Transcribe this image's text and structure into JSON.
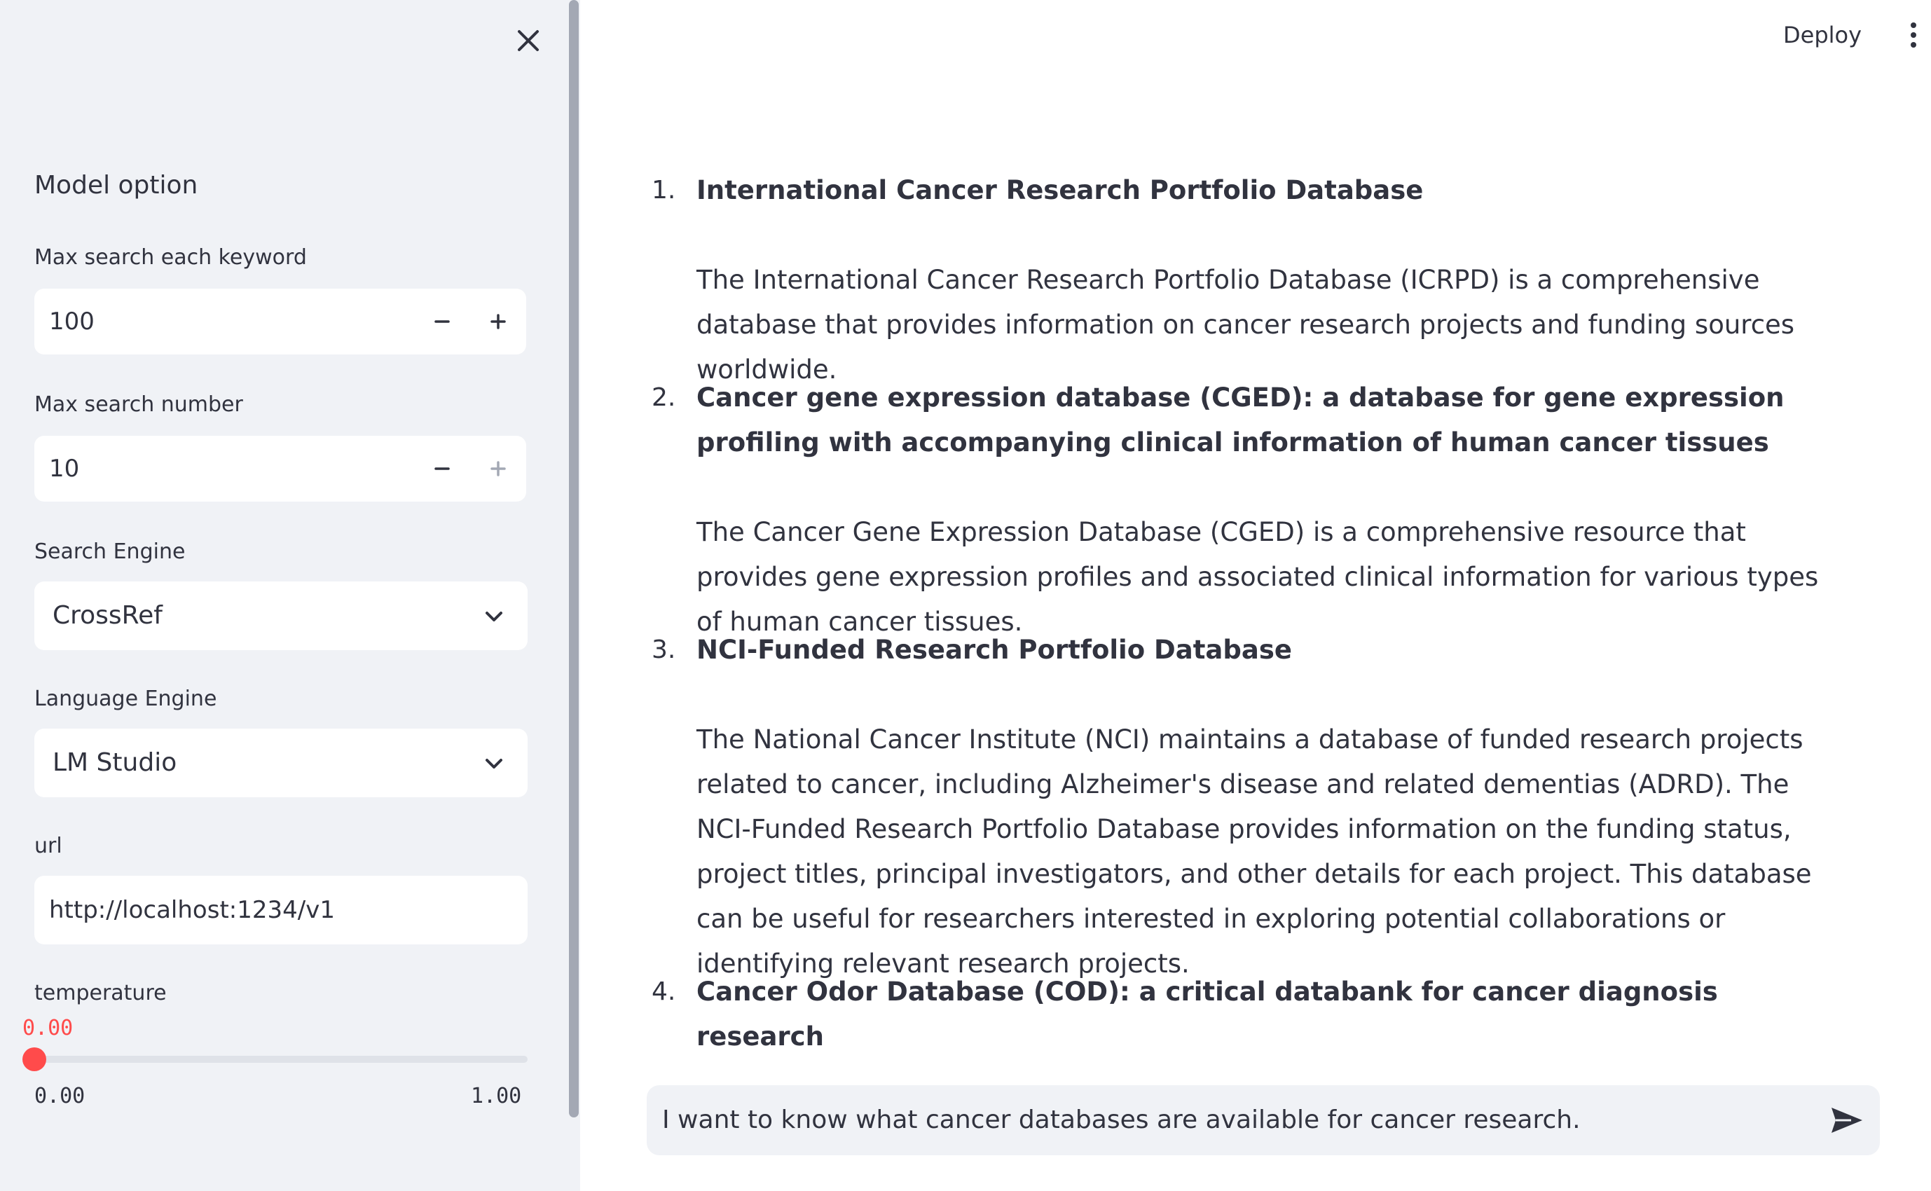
{
  "header": {
    "deploy_label": "Deploy"
  },
  "sidebar": {
    "heading": "Model option",
    "max_search_keyword": {
      "label": "Max search each keyword",
      "value": "100"
    },
    "max_search_number": {
      "label": "Max search number",
      "value": "10"
    },
    "search_engine": {
      "label": "Search Engine",
      "value": "CrossRef"
    },
    "language_engine": {
      "label": "Language Engine",
      "value": "LM Studio"
    },
    "url": {
      "label": "url",
      "value": "http://localhost:1234/v1"
    },
    "temperature": {
      "label": "temperature",
      "value": "0.00",
      "min": "0.00",
      "max": "1.00",
      "level": 0.0
    }
  },
  "results": [
    {
      "number": "1.",
      "title": "International Cancer Research Portfolio Database",
      "description": "The International Cancer Research Portfolio Database (ICRPD) is a comprehensive database that provides information on cancer research projects and funding sources worldwide."
    },
    {
      "number": "2.",
      "title": "Cancer gene expression database (CGED): a database for gene expression profiling with accompanying clinical information of human cancer tissues",
      "description": "The Cancer Gene Expression Database (CGED) is a comprehensive resource that provides gene expression profiles and associated clinical information for various types of human cancer tissues."
    },
    {
      "number": "3.",
      "title": "NCI-Funded Research Portfolio Database",
      "description": "The National Cancer Institute (NCI) maintains a database of funded research projects related to cancer, including Alzheimer's disease and related dementias (ADRD). The NCI-Funded Research Portfolio Database provides information on the funding status, project titles, principal investigators, and other details for each project. This database can be useful for researchers interested in exploring potential collaborations or identifying relevant research projects."
    },
    {
      "number": "4.",
      "title": "Cancer Odor Database (COD): a critical databank for cancer diagnosis research"
    }
  ],
  "chat_input": {
    "value": "I want to know what cancer databases are available for cancer research."
  },
  "colors": {
    "accent": "#ff4b4b",
    "sidebar_bg": "#f0f2f6",
    "text": "#31333f"
  }
}
